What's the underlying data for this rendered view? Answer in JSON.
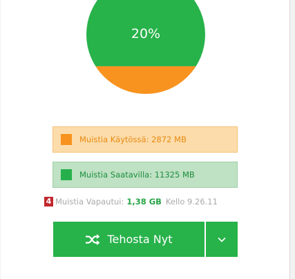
{
  "gauge": {
    "label": "20%",
    "used_fraction": 0.2,
    "colors": {
      "available": "#27b24a",
      "used": "#f7931e"
    }
  },
  "legend": {
    "used": {
      "label": "Muistia Käytössä: 2872 MB",
      "color": "#f7931e"
    },
    "available": {
      "label": "Muistia Saatavilla: 11325 MB",
      "color": "#26b04c"
    }
  },
  "freed": {
    "badge": "4",
    "label": "Muistia Vapautui:",
    "value": "1,38 GB",
    "time": "Kello  9.26.11"
  },
  "boost": {
    "label": "Tehosta Nyt",
    "icon": "shuffle-icon",
    "dropdown_icon": "chevron-down-icon"
  }
}
